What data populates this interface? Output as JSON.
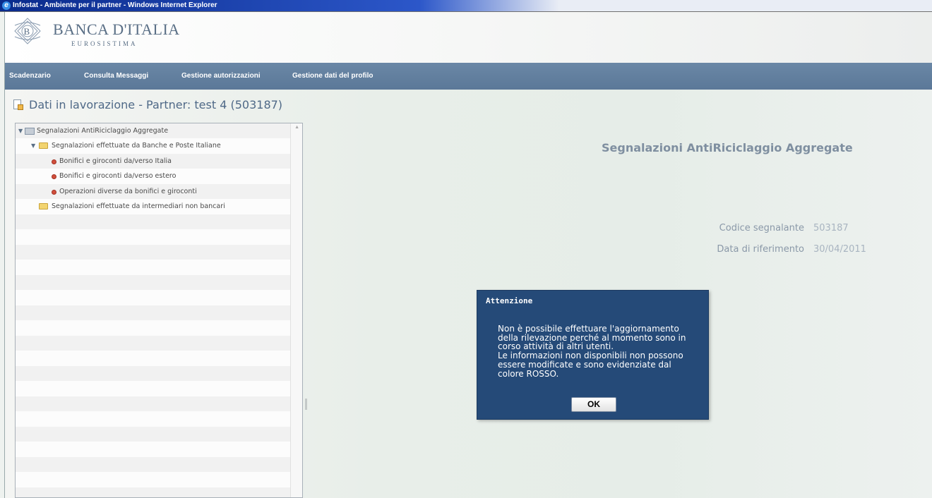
{
  "window": {
    "title": "Infostat - Ambiente per il partner - Windows Internet Explorer"
  },
  "header": {
    "logo_name": "BANCA D'ITALIA",
    "logo_sub": "EUROSISTIMA"
  },
  "nav": {
    "items": [
      {
        "label": "Scadenzario"
      },
      {
        "label": "Consulta Messaggi"
      },
      {
        "label": "Gestione autorizzazioni"
      },
      {
        "label": "Gestione dati del profilo"
      }
    ]
  },
  "page": {
    "title": "Dati in lavorazione - Partner: test 4 (503187)"
  },
  "tree": {
    "items": [
      {
        "label": "Segnalazioni AntiRiciclaggio Aggregate",
        "expanded": true,
        "icon": "root-folder-icon"
      },
      {
        "label": "Segnalazioni effettuate da  Banche e Poste Italiane",
        "expanded": true,
        "icon": "folder-icon"
      },
      {
        "label": "Bonifici e giroconti da/verso Italia",
        "icon": "red-status-icon"
      },
      {
        "label": "Bonifici e giroconti da/verso estero",
        "icon": "red-status-icon"
      },
      {
        "label": "Operazioni diverse da bonifici e giroconti",
        "icon": "red-status-icon"
      },
      {
        "label": "Segnalazioni effettuate da intermediari non bancari",
        "icon": "folder-icon"
      }
    ]
  },
  "detail": {
    "title": "Segnalazioni AntiRiciclaggio Aggregate",
    "fields": [
      {
        "label": "Codice segnalante",
        "value": "503187"
      },
      {
        "label": "Data di riferimento",
        "value": "30/04/2011"
      }
    ]
  },
  "dialog": {
    "title": "Attenzione",
    "message": "Non è possibile effettuare l'aggiornamento\ndella rilevazione perché al momento sono in\ncorso attività di altri utenti.\nLe informazioni non disponibili non possono\nessere modificate e sono evidenziate dal\ncolore ROSSO.",
    "ok_label": "OK"
  },
  "colors": {
    "nav_bg": "#5f7c9c",
    "dialog_bg": "#254a78",
    "status_red": "#d14f3c",
    "title_blue": "#4f6987"
  }
}
